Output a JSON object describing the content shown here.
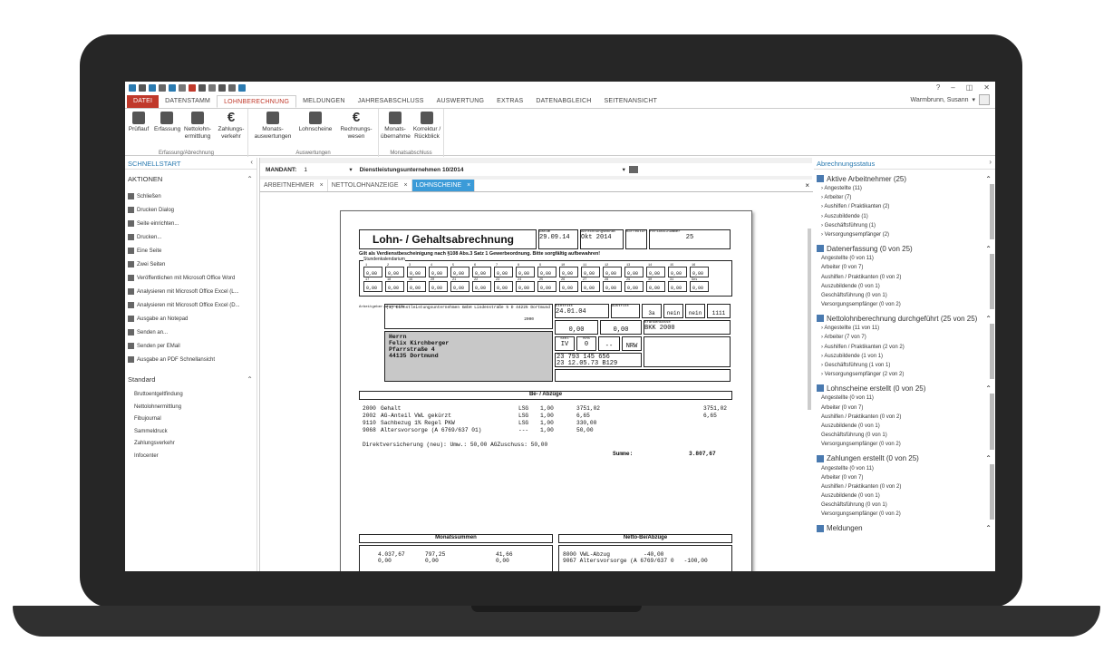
{
  "titlebar": {
    "window_controls": [
      "?",
      "–",
      "◫",
      "✕"
    ]
  },
  "tabs": [
    "DATEI",
    "DATENSTAMM",
    "LOHNBERECHNUNG",
    "MELDUNGEN",
    "JAHRESABSCHLUSS",
    "AUSWERTUNG",
    "EXTRAS",
    "DATENABGLEICH",
    "SEITENANSICHT"
  ],
  "active_tab": "LOHNBERECHNUNG",
  "user": "Warmbrunn, Susann",
  "ribbon": {
    "g1": {
      "caption": "Erfassung/Abrechnung",
      "b1": "Prüflauf",
      "b2": "Erfassung",
      "b3": "Nettolohn-\nermittlung",
      "b4": "Zahlungs-\nverkehr"
    },
    "g2": {
      "caption": "Auswertungen",
      "b1": "Monats-\nauswertungen",
      "b2": "Lohnscheine",
      "b3": "Rechnungs-\nwesen"
    },
    "g3": {
      "caption": "Monatsabschluss",
      "b1": "Monats-\nübernahme",
      "b2": "Korrektur /\nRückblick"
    }
  },
  "left": {
    "header": "SCHNELLSTART",
    "actions_title": "AKTIONEN",
    "actions": [
      "Schließen",
      "Drucken Dialog",
      "Seite einrichten...",
      "Drucken...",
      "Eine Seite",
      "Zwei Seiten",
      "Veröffentlichen mit Microsoft Office Word",
      "Analysieren mit Microsoft Office Excel (L...",
      "Analysieren mit Microsoft Office Excel (D...",
      "Ausgabe an Notepad",
      "Senden an...",
      "Senden per EMail",
      "Ausgabe an PDF Schnellansicht"
    ],
    "standard_title": "Standard",
    "standard": [
      "Bruttoentgeltfindung",
      "Nettolohnermittlung",
      "Fibujournal",
      "Sammeldruck",
      "Zahlungsverkehr",
      "Infocenter"
    ]
  },
  "center": {
    "mandant_label": "MANDANT:",
    "mandant_value": "1",
    "mandant_name": "Dienstleistungsunternehmen 10/2014",
    "doc_tabs": [
      "ARBEITNEHMER",
      "NETTOLOHNANZEIGE",
      "LOHNSCHEINE"
    ]
  },
  "paper": {
    "title": "Lohn- / Gehaltsabrechnung",
    "datum_label": "Datum",
    "datum": "29.09.14",
    "monat_label": "Abrechnungsmonat",
    "monat": "Okt 2014",
    "korrektur_label": "Korrektur",
    "pnr_label": "Personalnummer",
    "pnr": "25",
    "notice": "Gilt als Verdienstbescheinigung nach §108 Abs.3 Satz 1 Gewerbeordnung. Bitte sorgfältig aufbewahren!",
    "kalender_label": "Stundenkalendarium",
    "days_row1": [
      "1",
      "2",
      "3",
      "4",
      "5",
      "6",
      "7",
      "8",
      "9",
      "10",
      "11",
      "12",
      "13",
      "14",
      "15",
      "16"
    ],
    "days_row2": [
      "17",
      "18",
      "19",
      "20",
      "21",
      "22",
      "23",
      "24",
      "25",
      "26",
      "27",
      "28",
      "29",
      "30",
      "31",
      "Ges"
    ],
    "day_value": "0,00",
    "employer_label": "Arbeitgeber-anschrift",
    "employer": "(1) Dienstleistungsunternehmen GmbH  Lindenstraße 5 D 44225 Dortmund",
    "employer_code": "2000",
    "addr": [
      "Herrn",
      "Felix Kirchberger",
      "Pfarrstraße 4",
      "44135 Dortmund"
    ],
    "eintritt_label": "Eintritt",
    "eintritt": "24.01.04",
    "austritt_label": "Austritt",
    "stkl_label": "StKl",
    "stkl": "IV",
    "kfb_label": "KFB",
    "kfb": "0",
    "konf": "--",
    "bundesland": "NRW",
    "kasse_label": "Krankenkasse",
    "kasse": "BKK 2000",
    "pfz": "3a",
    "nein1": "nein",
    "nein2": "nein",
    "sv": "1111",
    "ssn": "23 793 145 656",
    "geb": "23 12.05.73 B129",
    "bezuege_title": "Be- / Abzüge",
    "lines": [
      {
        "nr": "2000",
        "text": "Gehalt",
        "art": "LSG",
        "menge": "1,00",
        "betrag": "3751,02",
        "end": "3751,02"
      },
      {
        "nr": "2002",
        "text": "AG-Anteil VWL gekürzt",
        "art": "LSG",
        "menge": "1,00",
        "betrag": "6,65",
        "end": "6,65"
      },
      {
        "nr": "9110",
        "text": "Sachbezug 1% Regel PKW",
        "art": "LSG",
        "menge": "1,00",
        "betrag": "330,00",
        "end": ""
      },
      {
        "nr": "9068",
        "text": "Altersvorsorge (A 6769/637 01)",
        "art": "---",
        "menge": "1,00",
        "betrag": "50,00",
        "end": ""
      }
    ],
    "direkt": "Direktversicherung (neu): Umw.: 50,00 AGZuschuss: 50,00",
    "summe_label": "Summe:",
    "summe": "3.807,67",
    "monatssummen": "Monatssummen",
    "netto_abzuege": "Netto-Be/Abzüge",
    "ms_vals": [
      "4.037,67",
      "0,00",
      "797,25",
      "0,00",
      "41,66",
      "0,00"
    ],
    "na_lines": [
      "8000 VWL-Abzug          -40,00",
      "9067 Altersvorsorge (A 6769/637 0   -100,00"
    ]
  },
  "right": {
    "header": "Abrechnungsstatus",
    "sections": [
      {
        "title": "Aktive Arbeitnehmer (25)",
        "items": [
          "Angestellte (11)",
          "Arbeiter (7)",
          "Aushilfen / Praktikanten (2)",
          "Auszubildende (1)",
          "Geschäftsführung (1)",
          "Versorgungsempfänger (2)"
        ]
      },
      {
        "title": "Datenerfassung (0 von 25)",
        "items": [
          "Angestellte (0 von 11)",
          "Arbeiter (0 von 7)",
          "Aushilfen / Praktikanten (0 von 2)",
          "Auszubildende (0 von 1)",
          "Geschäftsführung (0 von 1)",
          "Versorgungsempfänger (0 von 2)"
        ]
      },
      {
        "title": "Nettolohnberechnung durchgeführt (25 von 25)",
        "items": [
          "Angestellte (11 von 11)",
          "Arbeiter (7 von 7)",
          "Aushilfen / Praktikanten (2 von 2)",
          "Auszubildende (1 von 1)",
          "Geschäftsführung (1 von 1)",
          "Versorgungsempfänger (2 von 2)"
        ]
      },
      {
        "title": "Lohnscheine erstellt (0 von 25)",
        "items": [
          "Angestellte (0 von 11)",
          "Arbeiter (0 von 7)",
          "Aushilfen / Praktikanten (0 von 2)",
          "Auszubildende (0 von 1)",
          "Geschäftsführung (0 von 1)",
          "Versorgungsempfänger (0 von 2)"
        ]
      },
      {
        "title": "Zahlungen erstellt (0 von 25)",
        "items": [
          "Angestellte (0 von 11)",
          "Arbeiter (0 von 7)",
          "Aushilfen / Praktikanten (0 von 2)",
          "Auszubildende (0 von 1)",
          "Geschäftsführung (0 von 1)",
          "Versorgungsempfänger (0 von 2)"
        ]
      },
      {
        "title": "Meldungen",
        "items": []
      }
    ]
  }
}
